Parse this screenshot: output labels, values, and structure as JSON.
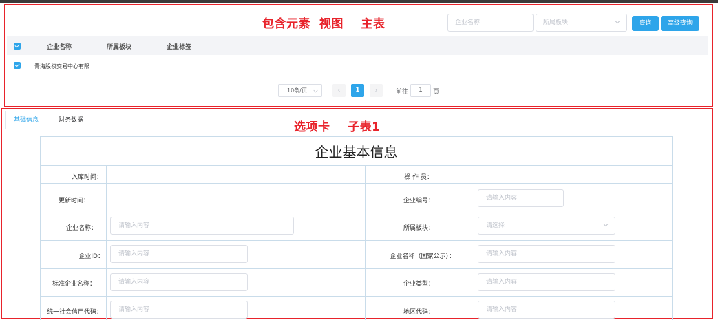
{
  "annotations": {
    "master": "包含元素  视图    主表",
    "detail": "选项卡    子表1"
  },
  "search": {
    "company_name_placeholder": "企业名称",
    "sector_placeholder": "所属板块",
    "query_label": "查询",
    "advanced_query_label": "高级查询"
  },
  "table": {
    "headers": [
      "企业名称",
      "所属板块",
      "企业标签"
    ],
    "rows": [
      {
        "company_name": "青海股权交易中心有限",
        "sector": "",
        "tags": ""
      }
    ]
  },
  "pagination": {
    "page_size": "10条/页",
    "prev": "‹",
    "current_page": "1",
    "next": "›",
    "goto_prefix": "前往",
    "goto_value": "1",
    "goto_suffix": "页"
  },
  "tabs": [
    {
      "label": "基础信息",
      "active": true
    },
    {
      "label": "财务数据",
      "active": false
    }
  ],
  "form": {
    "title": "企业基本信息",
    "fields": {
      "entry_time": {
        "label": "入库时间：",
        "value": ""
      },
      "operator": {
        "label": "操 作 员：",
        "value": ""
      },
      "update_time": {
        "label": "更新时间：",
        "value": ""
      },
      "company_code": {
        "label": "企业编号：",
        "placeholder": "请输入内容"
      },
      "company_name": {
        "label": "企业名称：",
        "placeholder": "请输入内容"
      },
      "sector": {
        "label": "所属板块：",
        "placeholder": "请选择"
      },
      "company_id": {
        "label": "企业ID：",
        "placeholder": "请输入内容"
      },
      "company_name_public": {
        "label": "企业名称（国家公示）：",
        "placeholder": "请输入内容"
      },
      "standard_name": {
        "label": "标准企业名称：",
        "placeholder": "请输入内容"
      },
      "company_type": {
        "label": "企业类型：",
        "placeholder": "请输入内容"
      },
      "credit_code": {
        "label": "统一社会信用代码：",
        "placeholder": "请输入内容"
      },
      "region_code": {
        "label": "地区代码：",
        "placeholder": "请输入内容"
      }
    }
  },
  "colors": {
    "annotation_red": "#e8232b",
    "primary_blue": "#2ea5ea",
    "border_blue": "#c9dcea"
  }
}
